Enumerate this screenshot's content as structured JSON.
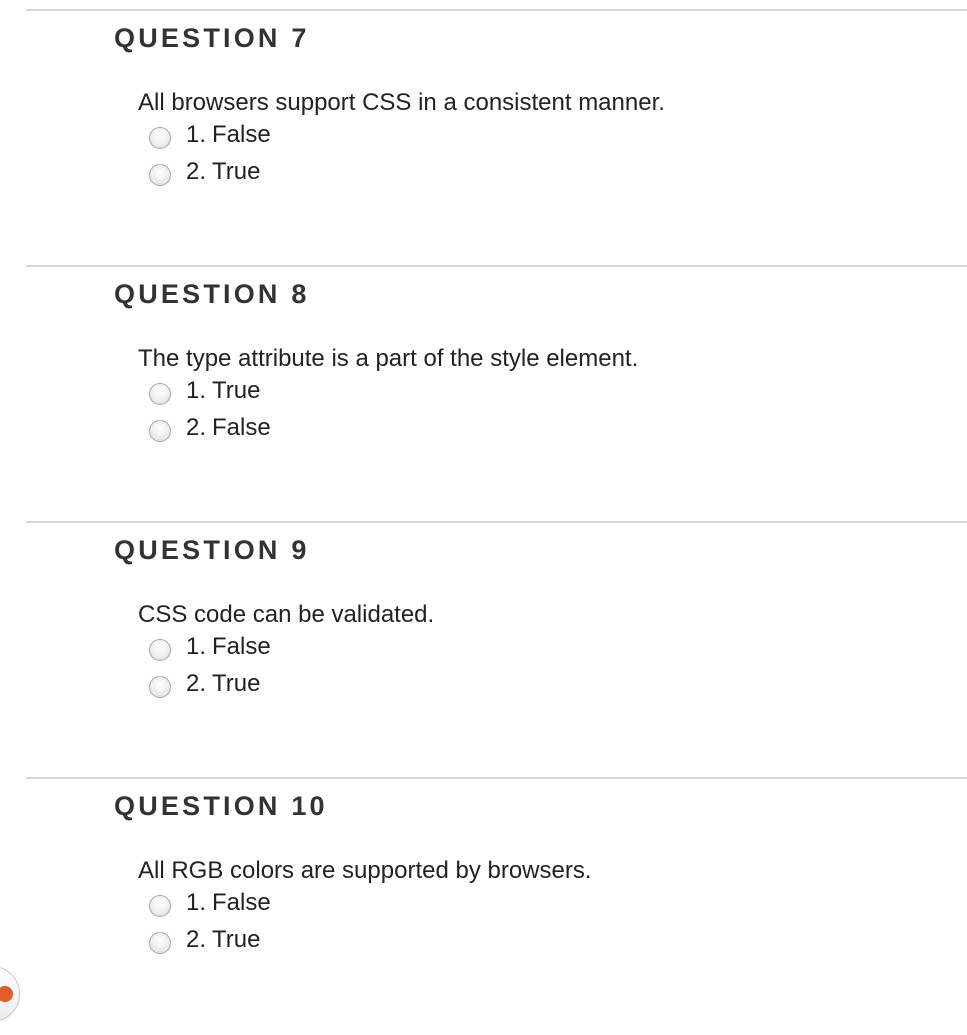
{
  "questions": [
    {
      "title": "QUESTION 7",
      "text": "All browsers support CSS in a consistent manner.",
      "options": [
        {
          "number": "1.",
          "label": "False"
        },
        {
          "number": "2.",
          "label": "True"
        }
      ]
    },
    {
      "title": "QUESTION 8",
      "text": "The type attribute is a part of the style element.",
      "options": [
        {
          "number": "1.",
          "label": "True"
        },
        {
          "number": "2.",
          "label": "False"
        }
      ]
    },
    {
      "title": "QUESTION 9",
      "text": "CSS code can be validated.",
      "options": [
        {
          "number": "1.",
          "label": "False"
        },
        {
          "number": "2.",
          "label": "True"
        }
      ]
    },
    {
      "title": "QUESTION 10",
      "text": "All RGB colors are supported by browsers.",
      "options": [
        {
          "number": "1.",
          "label": "False"
        },
        {
          "number": "2.",
          "label": "True"
        }
      ]
    }
  ],
  "colors": {
    "divider": "#d6d6d6",
    "title": "#333333",
    "nav_accent": "#e25b2a"
  },
  "icons": {
    "nav_button": "chevron-right-icon"
  }
}
